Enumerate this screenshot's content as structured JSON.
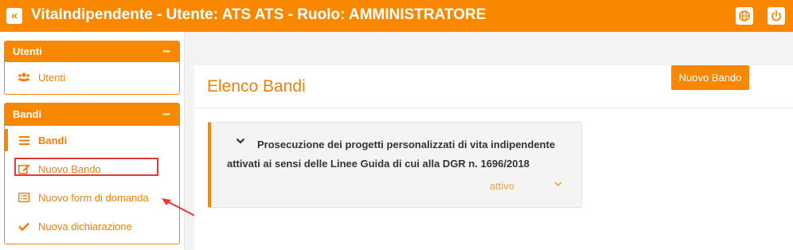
{
  "app": {
    "title": "VitaIndipendente - Utente: ATS ATS - Ruolo: AMMINISTRATORE",
    "collapse_icon": "double-chevron-left-icon",
    "globe_icon": "globe-icon",
    "power_icon": "power-icon",
    "accent_color": "#f98800"
  },
  "sidebar": {
    "users_panel": {
      "header": "Utenti",
      "toggle": "−",
      "items": [
        {
          "label": "Utenti",
          "icon": "users-icon"
        }
      ]
    },
    "bandi_panel": {
      "header": "Bandi",
      "toggle": "−",
      "items": [
        {
          "label": "Bandi",
          "icon": "list-icon",
          "active": true
        },
        {
          "label": "Nuovo Bando",
          "icon": "edit-icon"
        },
        {
          "label": "Nuovo form di domanda",
          "icon": "form-icon"
        },
        {
          "label": "Nuova dichiarazione",
          "icon": "check-icon"
        }
      ]
    }
  },
  "main": {
    "page_title": "Elenco Bandi",
    "new_button": "Nuovo Bando",
    "bando": {
      "title": "Prosecuzione dei progetti personalizzati di vita indipendente attivati ai sensi delle Linee Guida di cui alla DGR n. 1696/2018",
      "status": "attivo"
    }
  }
}
